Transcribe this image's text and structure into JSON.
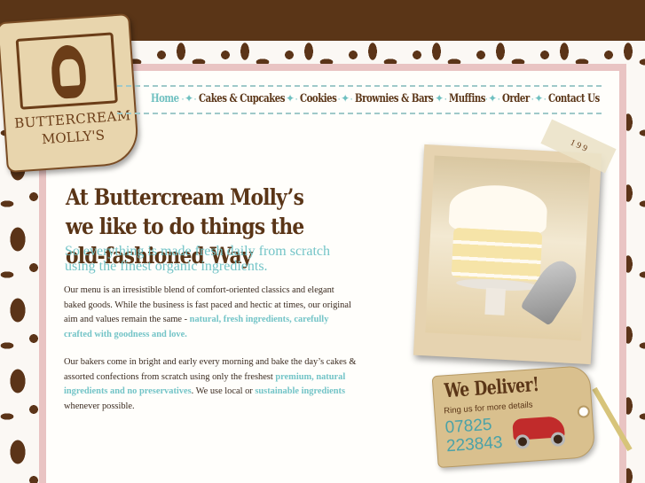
{
  "logo": {
    "line1": "BUTTERCREAM",
    "line2": "MOLLY'S"
  },
  "nav": {
    "items": [
      {
        "label": "Home",
        "active": true
      },
      {
        "label": "Cakes & Cupcakes",
        "active": false
      },
      {
        "label": "Cookies",
        "active": false
      },
      {
        "label": "Brownies & Bars",
        "active": false
      },
      {
        "label": "Muffins",
        "active": false
      },
      {
        "label": "Order",
        "active": false
      },
      {
        "label": "Contact Us",
        "active": false
      }
    ],
    "separator": "·✦·"
  },
  "main": {
    "headline": "At Buttercream Molly’s we like to do things the old-fashioned Way",
    "subhead": "So everything is made fresh daily from scratch using the finest organic ingredients.",
    "para1_a": "Our menu is an irresistible blend of comfort-oriented classics and elegant baked goods. While the business is fast paced and hectic at times, our original aim and values remain the same - ",
    "para1_hl": "natural, fresh ingredients, carefully crafted with goodness and love.",
    "para2_a": "Our bakers come in bright and early every morning and bake the day’s cakes & assorted confections from scratch using only the freshest ",
    "para2_hl1": "premium, natural ingredients and no preservatives",
    "para2_b": ". We use local or ",
    "para2_hl2": "sustainable ingredients",
    "para2_c": " whenever possible."
  },
  "tape_label": "1 9 9",
  "delivery": {
    "title": "We Deliver!",
    "sub": "Ring us for more details",
    "phone_line1": "07825",
    "phone_line2": "223843"
  },
  "colors": {
    "brown": "#5a3517",
    "teal": "#73c4c7",
    "pink": "#e9c4c3",
    "cream": "#fffefb"
  },
  "icons": [
    "logo-emblem-icon",
    "nav-separator-icon",
    "toy-car-icon"
  ]
}
